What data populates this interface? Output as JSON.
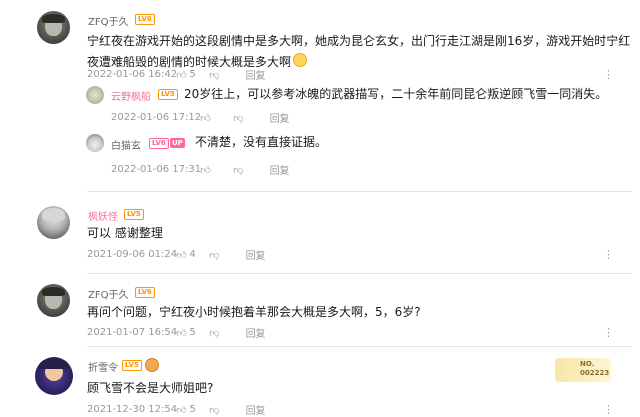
{
  "comments": [
    {
      "user": "ZFQ于久",
      "level": "LV6",
      "text": "宁红夜在游戏开始的这段剧情中是多大啊，她成为昆仑玄女，出门行走江湖是刚16岁，游戏开始时宁红夜遭难船毁的剧情的时候大概是多大啊",
      "date": "2022-01-06 16:42",
      "likes": "5",
      "reply_label": "回复",
      "replies": [
        {
          "user": "云野枫船",
          "level": "LV5",
          "text": "20岁往上，可以参考冰魄的武器描写，二十余年前同昆仑叛逆顾飞雪一同消失。",
          "date": "2022-01-06 17:12",
          "likes": "",
          "reply_label": "回复"
        },
        {
          "user": "白猫玄",
          "level": "LV6",
          "badge": "UP",
          "text": "不清楚，没有直接证据。",
          "date": "2022-01-06 17:31",
          "likes": "",
          "reply_label": "回复"
        }
      ]
    },
    {
      "user": "枫妖怪",
      "level": "LV5",
      "text": "可以 感谢整理",
      "date": "2021-09-06 01:24",
      "likes": "4",
      "reply_label": "回复"
    },
    {
      "user": "ZFQ于久",
      "level": "LV6",
      "text": "再问个问题，宁红夜小时候抱着羊那会大概是多大啊，5，6岁?",
      "date": "2021-01-07 16:54",
      "likes": "5",
      "reply_label": "回复"
    },
    {
      "user": "折雪令",
      "level": "LV5",
      "text": "顾飞雪不会是大师姐吧?",
      "date": "2021-12-30 12:54",
      "likes": "5",
      "reply_label": "回复",
      "badge_text": "NO.\n002223"
    }
  ],
  "colors": {
    "name_red": "#fb7299",
    "name_gray": "#61666d",
    "lv6": "#ff6699",
    "lv5": "#ff9500",
    "meta": "#9499a0"
  }
}
